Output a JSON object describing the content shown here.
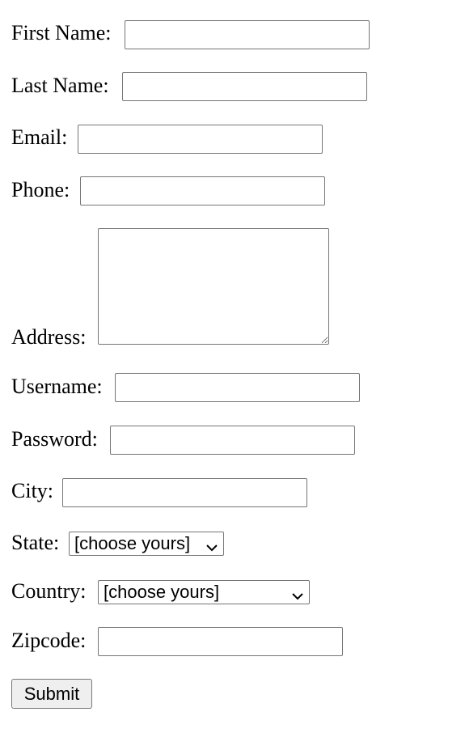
{
  "form": {
    "first_name": {
      "label": "First Name:",
      "value": ""
    },
    "last_name": {
      "label": "Last Name:",
      "value": ""
    },
    "email": {
      "label": "Email:",
      "value": ""
    },
    "phone": {
      "label": "Phone:",
      "value": ""
    },
    "address": {
      "label": "Address:",
      "value": ""
    },
    "username": {
      "label": "Username:",
      "value": ""
    },
    "password": {
      "label": "Password:",
      "value": ""
    },
    "city": {
      "label": "City:",
      "value": ""
    },
    "state": {
      "label": "State:",
      "selected": "[choose yours]"
    },
    "country": {
      "label": "Country:",
      "selected": "[choose yours]"
    },
    "zipcode": {
      "label": "Zipcode:",
      "value": ""
    },
    "submit_label": "Submit"
  },
  "icons": {
    "dropdown": "chevron-down-icon"
  }
}
